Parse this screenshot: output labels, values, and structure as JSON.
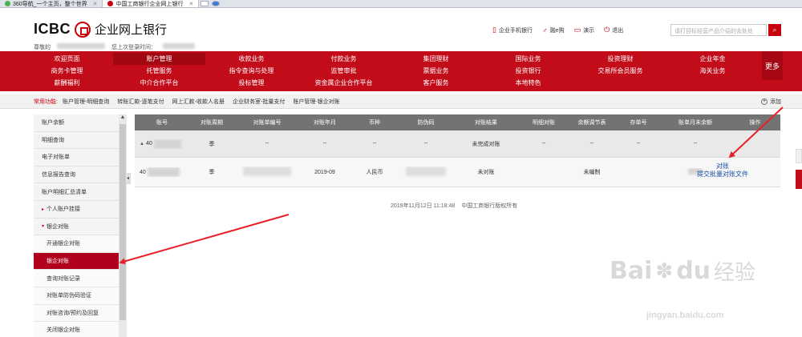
{
  "tabs": [
    {
      "label": "360导航_一个主页，整个世界",
      "active": false
    },
    {
      "label": "中国工商银行企业网上银行",
      "active": true
    }
  ],
  "header": {
    "logo_en": "ICBC",
    "logo_cn": "企业网上银行",
    "greeting": "尊敬的",
    "last_login": "您上次登录时间：",
    "links": [
      {
        "label": "企业手机银行",
        "icon": "phone-icon"
      },
      {
        "label": "融e购",
        "icon": "cart-icon"
      },
      {
        "label": "演示",
        "icon": "monitor-icon"
      },
      {
        "label": "退出",
        "icon": "power-icon"
      }
    ],
    "search_placeholder": "请打目标经营产品介绍的去处处"
  },
  "nav": {
    "items": [
      "欢迎页面",
      "账户管理",
      "收款业务",
      "付款业务",
      "集团理财",
      "国际业务",
      "投资理财",
      "企业年金",
      "商务卡管理",
      "托管服务",
      "指令查询与处理",
      "监管审批",
      "票据业务",
      "投资银行",
      "交易所会员服务",
      "海关业务",
      "薪酬福利",
      "中介合作平台",
      "投标管理",
      "资金属企业合作平台",
      "客户服务",
      "本地特色",
      "",
      ""
    ],
    "selected": "账户管理",
    "more_label": "更多"
  },
  "common": {
    "label": "常用功能:",
    "items": [
      "账户管理-明细查询",
      "转账汇款-逐笔支付",
      "网上汇款-收款人名册",
      "企业财务室-批量支付",
      "账户管理-银企对账"
    ],
    "add_label": "添加"
  },
  "sidebar": {
    "items": [
      {
        "label": "账户余额",
        "kind": "item"
      },
      {
        "label": "明细查询",
        "kind": "item"
      },
      {
        "label": "电子对账单",
        "kind": "item"
      },
      {
        "label": "信息报告查询",
        "kind": "item"
      },
      {
        "label": "账户明细汇总清单",
        "kind": "item"
      },
      {
        "label": "个人账户挂接",
        "kind": "group"
      },
      {
        "label": "银企对账",
        "kind": "group-open"
      },
      {
        "label": "开通银企对账",
        "kind": "sub"
      },
      {
        "label": "银企对账",
        "kind": "sub-active"
      },
      {
        "label": "查询对账记录",
        "kind": "sub"
      },
      {
        "label": "对账单防伪码验证",
        "kind": "sub"
      },
      {
        "label": "对账咨询/预约及回复",
        "kind": "sub"
      },
      {
        "label": "关闭银企对账",
        "kind": "sub"
      }
    ]
  },
  "table": {
    "headers": [
      "账号",
      "对账周期",
      "对账单编号",
      "对账年月",
      "币种",
      "防伪码",
      "对账结果",
      "明细对账",
      "余额调节表",
      "存单号",
      "账单月末余额",
      "操作"
    ],
    "rows": [
      {
        "account": "40",
        "cycle": "季",
        "number": "--",
        "period": "--",
        "currency": "--",
        "code": "--",
        "result": "未完成对账",
        "detail": "--",
        "balance_adj": "--",
        "deposit": "--",
        "month_end": "--",
        "ops": []
      },
      {
        "account": "40",
        "cycle": "季",
        "number": "030093218",
        "period": "2019-09",
        "currency": "人民币",
        "code": "0093218",
        "result": "未对账",
        "detail": "",
        "balance_adj": "未编制",
        "deposit": "",
        "month_end": "",
        "ops": [
          "对账",
          "提交批量对账文件"
        ]
      }
    ]
  },
  "footer": {
    "time": "2019年11月12日 11:18:48",
    "copyright": "中国工商银行版权所有"
  },
  "watermark": {
    "brand": "Bai",
    "brand2": "du",
    "cn": "经验",
    "url": "jingyan.baidu.com"
  },
  "colors": {
    "brand_red": "#c20c19",
    "active_red": "#b0001e",
    "arrow_red": "#e8202a",
    "link_blue": "#1a4fa0"
  }
}
